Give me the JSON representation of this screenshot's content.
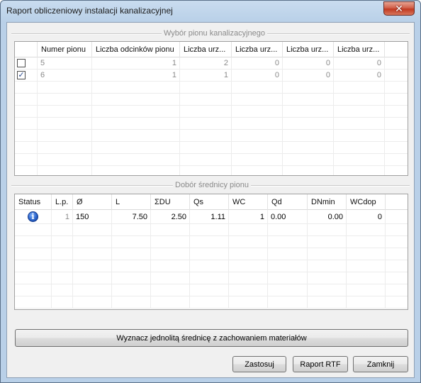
{
  "window": {
    "title": "Raport obliczeniowy instalacji kanalizacyjnej",
    "close_glyph": "✕"
  },
  "group1": {
    "label": "Wybór pionu kanalizacyjnego",
    "columns": [
      "",
      "Numer pionu",
      "Liczba odcinków pionu",
      "Liczba urz...",
      "Liczba urz...",
      "Liczba urz...",
      "Liczba urz..."
    ],
    "rows": [
      {
        "checked": false,
        "check_glyph": "",
        "values": [
          "5",
          "1",
          "2",
          "0",
          "0",
          "0"
        ]
      },
      {
        "checked": true,
        "check_glyph": "✓",
        "values": [
          "6",
          "1",
          "1",
          "0",
          "0",
          "0"
        ]
      }
    ]
  },
  "group2": {
    "label": "Dobór średnicy pionu",
    "columns": [
      "Status",
      "L.p.",
      "Ø",
      "L",
      "ΣDU",
      "Qs",
      "WC",
      "Qd",
      "DNmin",
      "WCdop"
    ],
    "rows": [
      {
        "status_icon": "info-icon",
        "status_glyph": "i",
        "values": [
          "1",
          "150",
          "7.50",
          "2.50",
          "1.11",
          "1",
          "0.00",
          "0.00",
          "0"
        ]
      }
    ]
  },
  "buttons": {
    "unify": "Wyznacz jednolitą średnicę z zachowaniem materiałów",
    "apply": "Zastosuj",
    "rtf": "Raport RTF",
    "close": "Zamknij"
  }
}
